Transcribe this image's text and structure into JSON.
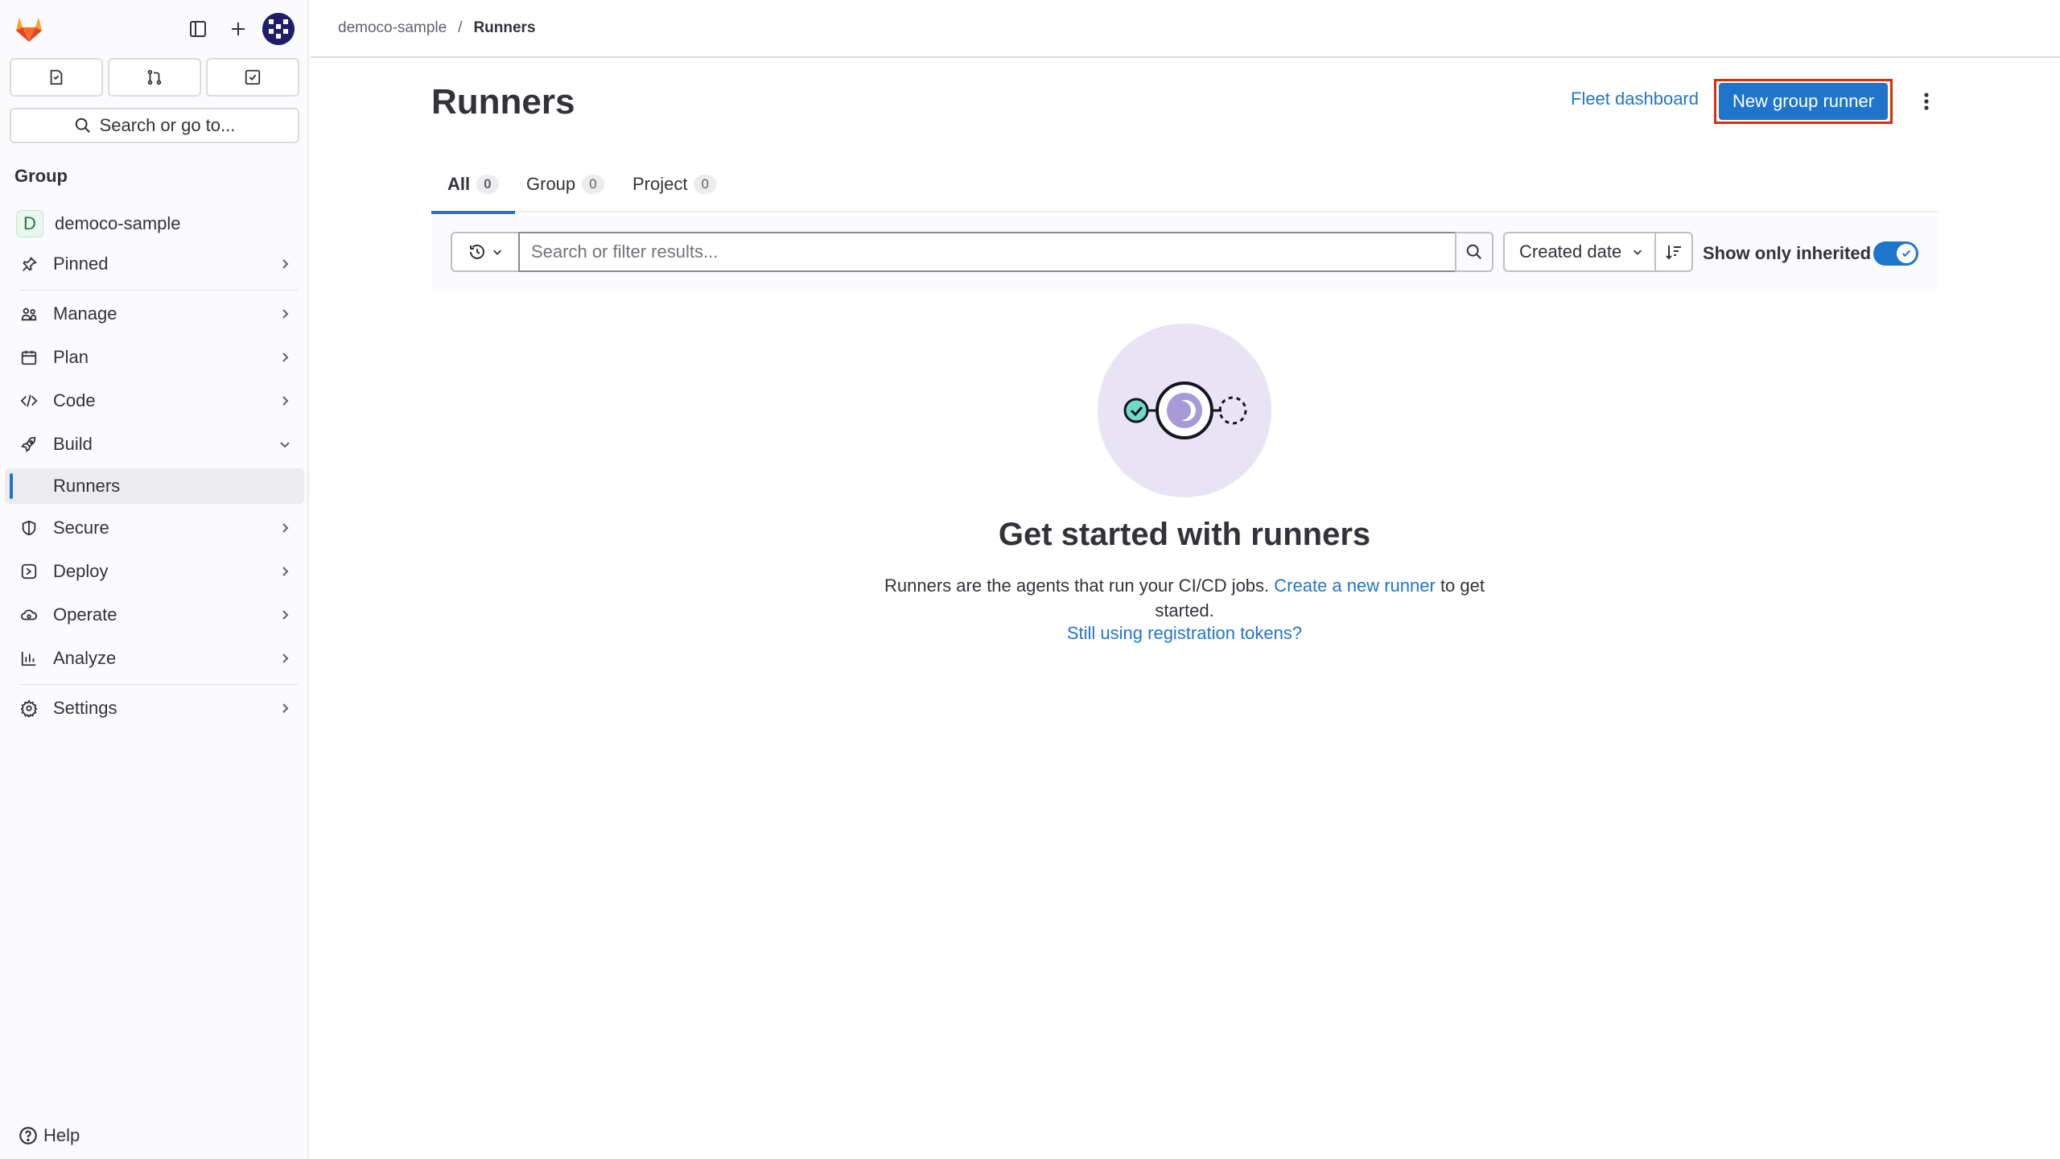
{
  "sidebar": {
    "search_label": "Search or go to...",
    "section_title": "Group",
    "group": {
      "initial": "D",
      "name": "democo-sample"
    },
    "items": [
      {
        "label": "Pinned"
      },
      {
        "label": "Manage"
      },
      {
        "label": "Plan"
      },
      {
        "label": "Code"
      },
      {
        "label": "Build"
      },
      {
        "label": "Runners"
      },
      {
        "label": "Secure"
      },
      {
        "label": "Deploy"
      },
      {
        "label": "Operate"
      },
      {
        "label": "Analyze"
      },
      {
        "label": "Settings"
      }
    ],
    "help_label": "Help"
  },
  "breadcrumb": {
    "parent": "democo-sample",
    "separator": "/",
    "current": "Runners"
  },
  "header": {
    "title": "Runners",
    "fleet_link": "Fleet dashboard",
    "new_runner_button": "New group runner"
  },
  "tabs": [
    {
      "label": "All",
      "count": "0"
    },
    {
      "label": "Group",
      "count": "0"
    },
    {
      "label": "Project",
      "count": "0"
    }
  ],
  "filter": {
    "search_placeholder": "Search or filter results...",
    "sort_label": "Created date",
    "inherited_label": "Show only inherited",
    "inherited_on": true
  },
  "empty_state": {
    "title": "Get started with runners",
    "text_before": "Runners are the agents that run your CI/CD jobs. ",
    "link": "Create a new runner",
    "text_after": " to get started.",
    "secondary_link": "Still using registration tokens?"
  },
  "colors": {
    "accent": "#1f75cb",
    "highlight_border": "#dd2b0e",
    "illustration_bg": "#e8e4f3"
  }
}
